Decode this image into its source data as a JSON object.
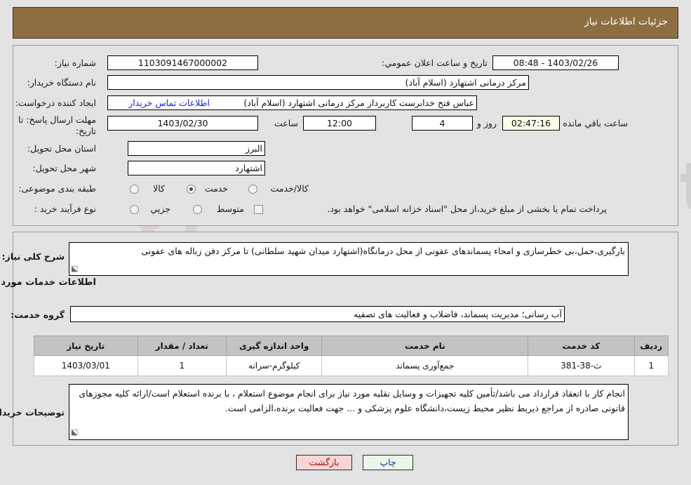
{
  "header": {
    "title": "جزئیات اطلاعات نیاز"
  },
  "form": {
    "need_number_label": "شماره نیاز:",
    "need_number_value": "1103091467000002",
    "buyer_org_label": "نام دستگاه خریدار:",
    "buyer_org_value": "مرکز درمانی اشتهارد (اسلام آباد)",
    "creator_label": "ایجاد کننده درخواست:",
    "creator_value": "عباس فتح خدابرست کاربرداز مرکز درمانی اشتهارد (اسلام آباد)",
    "buyer_contact_link": "اطلاعات تماس خریدار",
    "deadline_label": "مهلت ارسال پاسخ: تا تاریخ:",
    "deadline_date": "1403/02/30",
    "hour_label": "ساعت",
    "deadline_time": "12:00",
    "days_value": "4",
    "days_unit_label": "روز و",
    "countdown_value": "02:47:16",
    "countdown_suffix": "ساعت باقي مانده",
    "announce_label": "تاریخ و ساعت اعلان عمومي:",
    "announce_value": "1403/02/26 - 08:48",
    "province_label": "استان محل تحویل:",
    "province_value": "البرز",
    "city_label": "شهر محل تحویل:",
    "city_value": "اشتهارد",
    "category_label": "طبقه بندی موضوعی:",
    "category_options": [
      "کالا",
      "خدمت",
      "کالا/خدمت"
    ],
    "category_selected": "خدمت",
    "process_label": "نوع فرآیند خرید :",
    "process_options": [
      "جزیي",
      "متوسط"
    ],
    "process_selected": "",
    "treasury_checkbox_text": "پرداخت تمام یا بخشی از مبلغ خرید،از محل \"اسناد خزانه اسلامی\" خواهد بود.",
    "treasury_checked": false
  },
  "description": {
    "general_label": "شرح کلی نیاز:",
    "general_value": "بارگیری،حمل،بی خطرسازی و امحاء پسماندهای عفونی از محل درمانگاه(اشتهارد میدان شهید سلطانی) تا مرکز دفن زباله های عفونی",
    "services_heading": "اطلاعات خدمات مورد نیاز",
    "service_group_label": "گروه خدمت:",
    "service_group_value": "آب رسانی؛ مدیریت پسماند، فاضلاب و فعالیت های تصفیه"
  },
  "table": {
    "columns": [
      "ردیف",
      "کد خدمت",
      "نام خدمت",
      "واحد اندازه گیری",
      "تعداد / مقدار",
      "تاریخ نیاز"
    ],
    "rows": [
      {
        "row_no": "1",
        "service_code": "ث-38-381",
        "service_name": "جمع‌آوری پسماند",
        "unit": "کیلوگرم-سرانه",
        "quantity": "1",
        "need_date": "1403/03/01"
      }
    ]
  },
  "buyer_notes": {
    "label": "توضیحات خریدار:",
    "value": "انجام کار با انعقاد قرارداد می باشد/تأمین کلیه تجهیزات و وسایل نقلیه مورد نیاز برای انجام موضوع استعلام ، با برنده استعلام است/ارائه کلیه مجوزهای قانونی صادره از مراجع ذیربط نظیر محیط زیست،دانشگاه علوم پزشکی و ... جهت فعالیت برنده،الزامی است."
  },
  "footer": {
    "print_label": "چاپ",
    "back_label": "بازگشت"
  },
  "watermark": {
    "text": "AriaTender.net"
  },
  "colors": {
    "header_bg": "#8d6e41",
    "page_bg": "#e3e3e3",
    "link": "#2020e0",
    "table_header_bg": "#c3c3c3",
    "back_btn_bg": "#fbd5d5",
    "print_btn_bg": "#e9f7e9",
    "countdown_bg": "#fbfbe8"
  }
}
